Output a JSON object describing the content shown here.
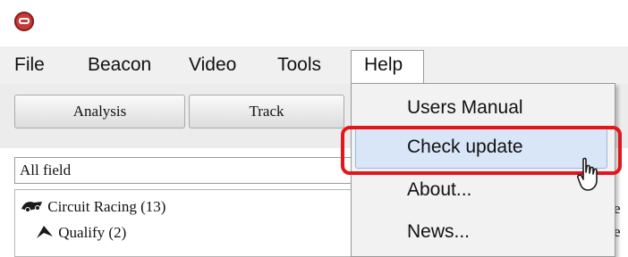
{
  "menubar": {
    "file": "File",
    "beacon": "Beacon",
    "video": "Video",
    "tools": "Tools",
    "help": "Help"
  },
  "toolbar": {
    "analysis": "Analysis",
    "track": "Track"
  },
  "filter": {
    "value": "All field"
  },
  "tree": {
    "items": [
      {
        "label": "Circuit Racing (13)",
        "icon": "race-car-icon"
      },
      {
        "label": "Qualify (2)",
        "icon": "flag-icon"
      }
    ]
  },
  "help_menu": {
    "items": [
      "Users Manual",
      "Check update",
      "About...",
      "News..."
    ],
    "highlighted": "Check update"
  },
  "colors": {
    "highlight": "#d9e6f8",
    "callout": "#e3161c"
  }
}
